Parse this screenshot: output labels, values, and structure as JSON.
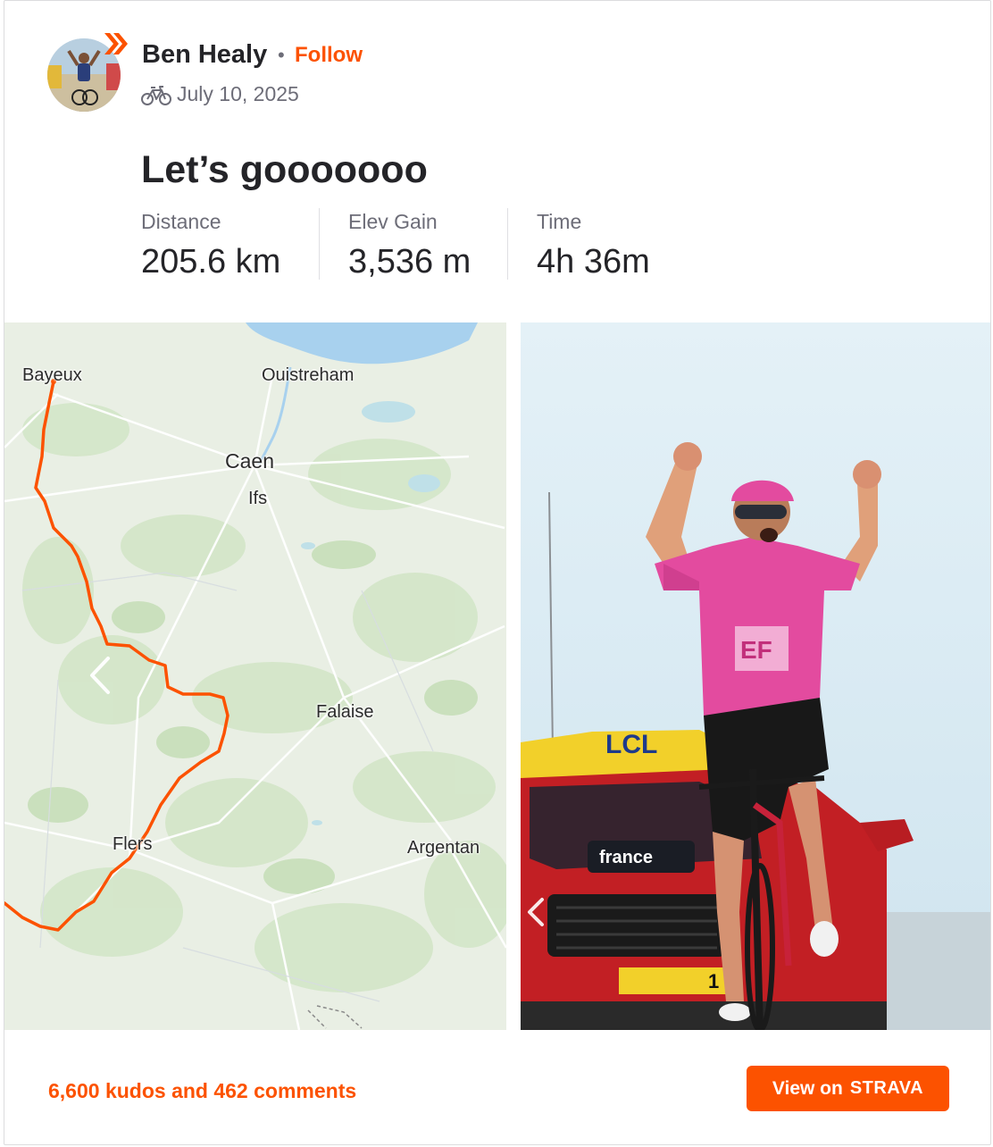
{
  "athlete": {
    "name": "Ben Healy",
    "separator": "•",
    "follow_label": "Follow",
    "activity_icon": "bike-icon",
    "date": "July 10, 2025",
    "avatar_icon": "avatar"
  },
  "activity": {
    "title": "Let’s gooooooo",
    "stats": [
      {
        "label": "Distance",
        "value": "205.6 km"
      },
      {
        "label": "Elev Gain",
        "value": "3,536 m"
      },
      {
        "label": "Time",
        "value": "4h 36m"
      }
    ]
  },
  "map": {
    "route_color": "#fc5200",
    "places": [
      {
        "name": "Bayeux"
      },
      {
        "name": "Ouistreham"
      },
      {
        "name": "Caen"
      },
      {
        "name": "Ifs"
      },
      {
        "name": "Falaise"
      },
      {
        "name": "Flers"
      },
      {
        "name": "Argentan"
      }
    ],
    "prev_icon": "chevron-left-icon"
  },
  "photo": {
    "banner_text": "LCL",
    "car_text": "france",
    "plate_text": "1",
    "jersey_text": "EF"
  },
  "footer": {
    "kudos_text": "6,600 kudos and 462 comments",
    "view_label": "View on",
    "brand": "STRAVA"
  },
  "colors": {
    "accent": "#fc5200",
    "text": "#242428",
    "muted": "#6d6d78"
  }
}
